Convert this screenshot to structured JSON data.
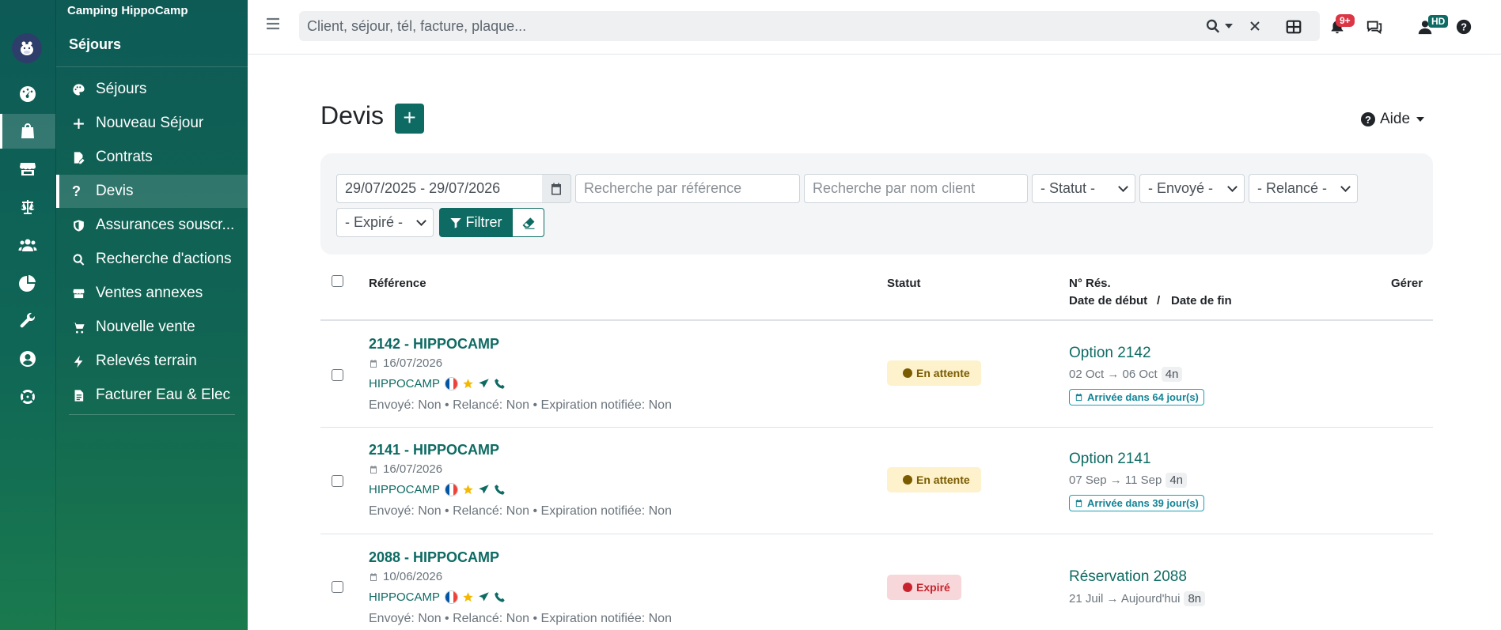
{
  "app": {
    "camping_name": "Camping HippoCamp",
    "section_title": "Séjours"
  },
  "sidebar": {
    "items": [
      {
        "label": "Séjours",
        "icon": "palette-icon"
      },
      {
        "label": "Nouveau Séjour",
        "icon": "plus-icon"
      },
      {
        "label": "Contrats",
        "icon": "signature-icon"
      },
      {
        "label": "Devis",
        "icon": "question-icon",
        "active": true
      },
      {
        "label": "Assurances souscr...",
        "icon": "shield-icon"
      },
      {
        "label": "Recherche d'actions",
        "icon": "search-icon"
      },
      {
        "label": "Ventes annexes",
        "icon": "store-icon"
      },
      {
        "label": "Nouvelle vente",
        "icon": "cart-icon"
      },
      {
        "label": "Relevés terrain",
        "icon": "bolt-icon"
      },
      {
        "label": "Facturer Eau & Elec",
        "icon": "invoice-icon"
      }
    ]
  },
  "topbar": {
    "search_placeholder": "Client, séjour, tél, facture, plaque...",
    "notifications_badge": "9+",
    "user_initials": "HD"
  },
  "page": {
    "title": "Devis",
    "add_label": "+",
    "help_label": "Aide"
  },
  "filters": {
    "date_range": "29/07/2025 - 29/07/2026",
    "ref_placeholder": "Recherche par référence",
    "client_placeholder": "Recherche par nom client",
    "statut": "- Statut -",
    "envoye": "- Envoyé -",
    "relance": "- Relancé -",
    "expire": "- Expiré -",
    "filter_label": "Filtrer"
  },
  "table": {
    "headers": {
      "reference": "Référence",
      "statut": "Statut",
      "num_res": "N° Rés.",
      "date_debut": "Date de début",
      "slash": "/",
      "date_fin": "Date de fin",
      "gerer": "Gérer"
    },
    "rows": [
      {
        "ref": "2142 - HIPPOCAMP",
        "date": "16/07/2026",
        "client": "HIPPOCAMP",
        "meta": "Envoyé: Non • Relancé: Non • Expiration notifiée: Non",
        "status": "En attente",
        "status_type": "wait",
        "res": "Option 2142",
        "dates": "02 Oct → 06 Oct",
        "nights": "4n",
        "arrival": "Arrivée dans 64 jour(s)"
      },
      {
        "ref": "2141 - HIPPOCAMP",
        "date": "16/07/2026",
        "client": "HIPPOCAMP",
        "meta": "Envoyé: Non • Relancé: Non • Expiration notifiée: Non",
        "status": "En attente",
        "status_type": "wait",
        "res": "Option 2141",
        "dates": "07 Sep → 11 Sep",
        "nights": "4n",
        "arrival": "Arrivée dans 39 jour(s)"
      },
      {
        "ref": "2088 - HIPPOCAMP",
        "date": "10/06/2026",
        "client": "HIPPOCAMP",
        "meta": "Envoyé: Non • Relancé: Non • Expiration notifiée: Non",
        "status": "Expiré",
        "status_type": "expired",
        "res": "Réservation 2088",
        "dates": "21 Juil → Aujourd'hui",
        "nights": "8n",
        "arrival": ""
      }
    ]
  },
  "colors": {
    "brand": "#0e6b63",
    "sidebar": "#0e5b56",
    "wait": "#fdf2cc",
    "expired": "#f8d7da"
  }
}
